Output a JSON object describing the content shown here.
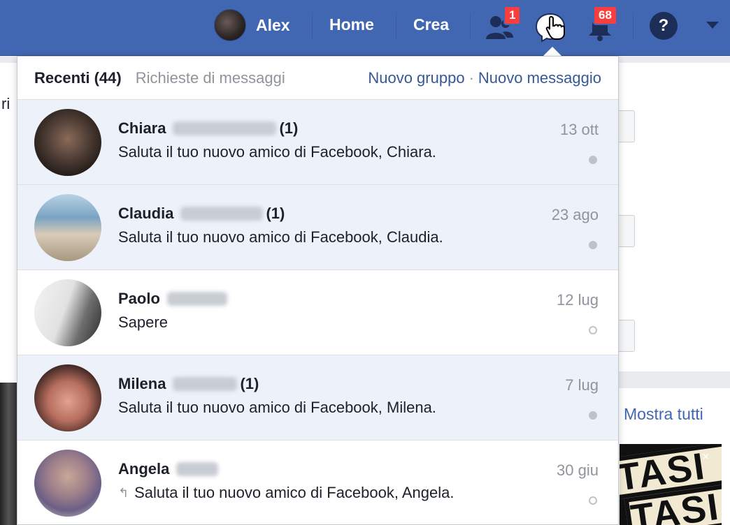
{
  "topbar": {
    "user_name": "Alex",
    "home_label": "Home",
    "create_label": "Crea",
    "friend_requests_badge": "1",
    "notifications_badge": "68",
    "help_label": "?"
  },
  "dropdown": {
    "tab_recent": "Recenti (44)",
    "tab_requests": "Richieste di messaggi",
    "new_group": "Nuovo gruppo",
    "separator": "·",
    "new_message": "Nuovo messaggio",
    "messages": [
      {
        "first_name": "Chiara",
        "count": "(1)",
        "preview": "Saluta il tuo nuovo amico di Facebook, Chiara.",
        "time": "13 ott",
        "unread": true
      },
      {
        "first_name": "Claudia",
        "count": "(1)",
        "preview": "Saluta il tuo nuovo amico di Facebook, Claudia.",
        "time": "23 ago",
        "unread": true
      },
      {
        "first_name": "Paolo",
        "count": "",
        "preview": "Sapere",
        "time": "12 lug",
        "unread": false
      },
      {
        "first_name": "Milena",
        "count": "(1)",
        "preview": "Saluta il tuo nuovo amico di Facebook, Milena.",
        "time": "7 lug",
        "unread": true
      },
      {
        "first_name": "Angela",
        "count": "",
        "preview": "Saluta il tuo nuovo amico di Facebook, Angela.",
        "time": "30 giu",
        "unread": false
      }
    ]
  },
  "background": {
    "show_all": "Mostra tutti",
    "left_fragment": "ri",
    "ad_text": "TASI",
    "ad_close": "×"
  },
  "colors": {
    "brand_blue": "#4267b2",
    "unread_row": "#edf2fa",
    "badge_red": "#fa3e3e",
    "link_blue": "#365899"
  },
  "icons": [
    "friend-requests-icon",
    "messenger-icon",
    "pointer-hand-icon",
    "notifications-bell-icon",
    "help-icon",
    "account-menu-caret-icon",
    "reply-arrow-icon",
    "read-status-dot-icon"
  ]
}
